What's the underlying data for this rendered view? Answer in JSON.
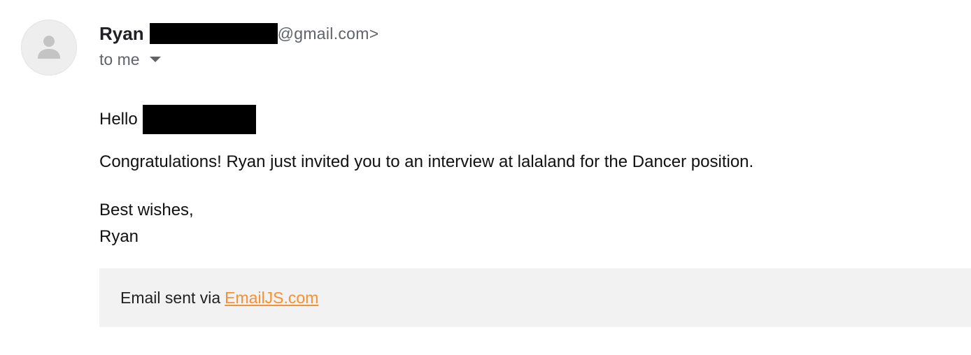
{
  "sender": {
    "name": "Ryan",
    "email_suffix": "@gmail.com>"
  },
  "recipient": {
    "label": "to me"
  },
  "icons": {
    "avatar": "person-icon",
    "recipient_dropdown": "caret-down-icon"
  },
  "message": {
    "greeting": "Hello",
    "body": "Congratulations! Ryan just invited you to an interview at lalaland for the Dancer position.",
    "closing": "Best wishes,",
    "signature": "Ryan"
  },
  "footer": {
    "text": "Email sent via",
    "link_text": "EmailJS.com",
    "link_color": "#f79033",
    "background": "#f2f2f2"
  }
}
